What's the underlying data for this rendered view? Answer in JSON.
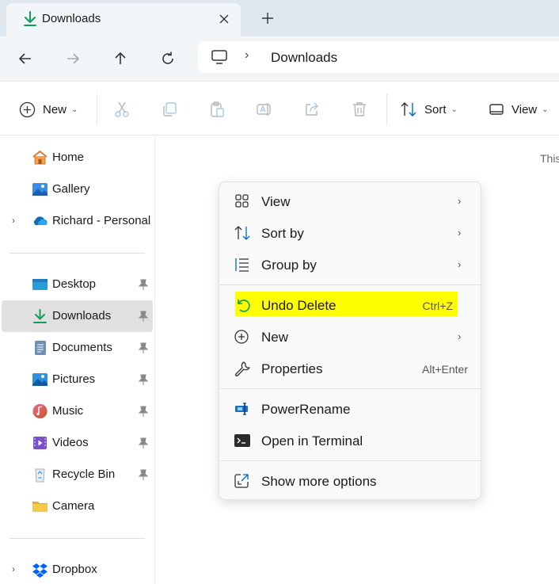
{
  "window": {
    "tab_title": "Downloads",
    "tab_icon": "download-icon",
    "close_tab_glyph": "✕",
    "new_tab_glyph": "+"
  },
  "navigation": {
    "back": "back-arrow-icon",
    "forward": "forward-arrow-icon",
    "up": "up-arrow-icon",
    "refresh": "refresh-icon",
    "address": {
      "root_icon": "this-pc-icon",
      "separator": "›",
      "crumbs": [
        "Downloads"
      ]
    }
  },
  "toolbar": {
    "new_label": "New",
    "sort_label": "Sort",
    "view_label": "View",
    "chevron": "⌄",
    "icons": [
      "cut-icon",
      "copy-icon",
      "paste-icon",
      "rename-icon",
      "share-icon",
      "delete-icon"
    ]
  },
  "sidebar": {
    "items": [
      {
        "label": "Home",
        "icon": "home-icon",
        "pinned": false,
        "expandable": false
      },
      {
        "label": "Gallery",
        "icon": "gallery-icon",
        "pinned": false,
        "expandable": false
      },
      {
        "label": "Richard - Personal",
        "icon": "onedrive-icon",
        "pinned": false,
        "expandable": true
      },
      {
        "label": "Desktop",
        "icon": "desktop-icon",
        "pinned": true,
        "expandable": false
      },
      {
        "label": "Downloads",
        "icon": "downloads-icon",
        "pinned": true,
        "expandable": false,
        "selected": true
      },
      {
        "label": "Documents",
        "icon": "documents-icon",
        "pinned": true,
        "expandable": false
      },
      {
        "label": "Pictures",
        "icon": "pictures-icon",
        "pinned": true,
        "expandable": false
      },
      {
        "label": "Music",
        "icon": "music-icon",
        "pinned": true,
        "expandable": false
      },
      {
        "label": "Videos",
        "icon": "videos-icon",
        "pinned": true,
        "expandable": false
      },
      {
        "label": "Recycle Bin",
        "icon": "recycle-bin-icon",
        "pinned": true,
        "expandable": false
      },
      {
        "label": "Camera",
        "icon": "folder-icon",
        "pinned": false,
        "expandable": false
      },
      {
        "label": "Dropbox",
        "icon": "dropbox-icon",
        "pinned": false,
        "expandable": true
      }
    ],
    "expander_glyph": "›"
  },
  "content": {
    "hint_text": "This"
  },
  "context_menu": {
    "items": [
      {
        "label": "View",
        "icon": "view-grid-icon",
        "submenu": true
      },
      {
        "label": "Sort by",
        "icon": "sort-icon",
        "submenu": true
      },
      {
        "label": "Group by",
        "icon": "group-icon",
        "submenu": true
      },
      {
        "label": "Undo Delete",
        "icon": "undo-icon",
        "shortcut": "Ctrl+Z",
        "highlighted": true
      },
      {
        "label": "New",
        "icon": "new-plus-icon",
        "submenu": true
      },
      {
        "label": "Properties",
        "icon": "wrench-icon",
        "shortcut": "Alt+Enter"
      },
      {
        "label": "PowerRename",
        "icon": "powerrename-icon"
      },
      {
        "label": "Open in Terminal",
        "icon": "terminal-icon"
      },
      {
        "label": "Show more options",
        "icon": "show-more-icon"
      }
    ],
    "chevron_glyph": "›",
    "highlight_color": "#ffff00"
  },
  "colors": {
    "accent_green": "#0f9d58",
    "accent_blue": "#0067c0",
    "titlebar_bg": "#dfe7ef",
    "selected_bg": "#e0e0e0"
  }
}
